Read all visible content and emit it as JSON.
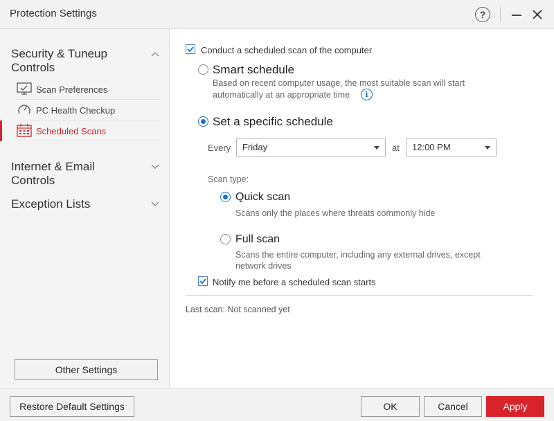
{
  "window": {
    "title": "Protection Settings",
    "help_label": "?",
    "minimize_label": "—",
    "close_label": "✕"
  },
  "sidebar": {
    "groups": [
      {
        "label_line1": "Security & Tuneup",
        "label_line2": "Controls",
        "expanded": true,
        "items": [
          {
            "label": "Scan Preferences",
            "icon": "monitor-icon",
            "active": false
          },
          {
            "label": "PC Health Checkup",
            "icon": "gauge-icon",
            "active": false
          },
          {
            "label": "Scheduled Scans",
            "icon": "calendar-icon",
            "active": true
          }
        ]
      },
      {
        "label_line1": "Internet & Email",
        "label_line2": "Controls",
        "expanded": false
      },
      {
        "label_line1": "Exception Lists",
        "expanded": false
      }
    ],
    "other_settings_label": "Other Settings"
  },
  "main": {
    "conduct_scan": {
      "label": "Conduct a scheduled scan of the computer",
      "checked": true
    },
    "smart_schedule": {
      "label": "Smart schedule",
      "description_line1": "Based on recent computer usage, the most suitable scan will start",
      "description_line2": "automatically at an appropriate time",
      "selected": false,
      "info_icon": "info-icon"
    },
    "specific_schedule": {
      "label": "Set a specific schedule",
      "selected": true,
      "every_label": "Every",
      "day_value": "Friday",
      "at_label": "at",
      "time_value": "12:00 PM"
    },
    "scan_type": {
      "label": "Scan type:",
      "options": [
        {
          "label": "Quick scan",
          "description_line1": "Scans only the places where threats commonly hide",
          "description_line2": "",
          "selected": true
        },
        {
          "label": "Full scan",
          "description_line1": "Scans the entire computer, including any external drives, except",
          "description_line2": "network drives",
          "selected": false
        }
      ]
    },
    "notify": {
      "label": "Notify me before a scheduled scan starts",
      "checked": true
    },
    "last_scan": "Last scan: Not scanned yet"
  },
  "footer": {
    "restore_label": "Restore Default Settings",
    "ok_label": "OK",
    "cancel_label": "Cancel",
    "apply_label": "Apply"
  },
  "colors": {
    "accent_red": "#d8232a",
    "accent_blue": "#1a73c8"
  }
}
